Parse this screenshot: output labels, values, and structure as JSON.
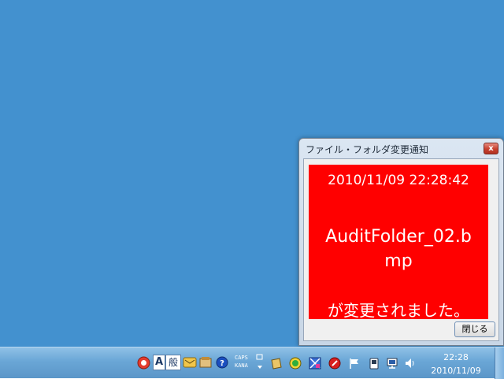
{
  "window": {
    "title": "ファイル・フォルダ変更通知",
    "close_symbol": "x",
    "timestamp": "2010/11/09 22:28:42",
    "filename": "AuditFolder_02.bmp",
    "message": "が変更されました。",
    "close_button_label": "閉じる",
    "alert_color": "#ff0000"
  },
  "taskbar": {
    "ime": {
      "input_char": "A",
      "mode_label": "般"
    },
    "caps_label": "CAPS",
    "kana_label": "KANA",
    "tray_icons": [
      "red-app-icon",
      "ime-pad-icon",
      "ime-dictionary-icon",
      "help-icon",
      "note-icon",
      "green-app-icon",
      "network-app-icon",
      "red-circle-icon",
      "flag-icon",
      "phone-icon",
      "network-icon",
      "volume-icon"
    ],
    "clock_time": "22:28",
    "clock_date": "2010/11/09"
  },
  "colors": {
    "desktop": "#4391cf",
    "taskbar": "#6aa6d6"
  }
}
